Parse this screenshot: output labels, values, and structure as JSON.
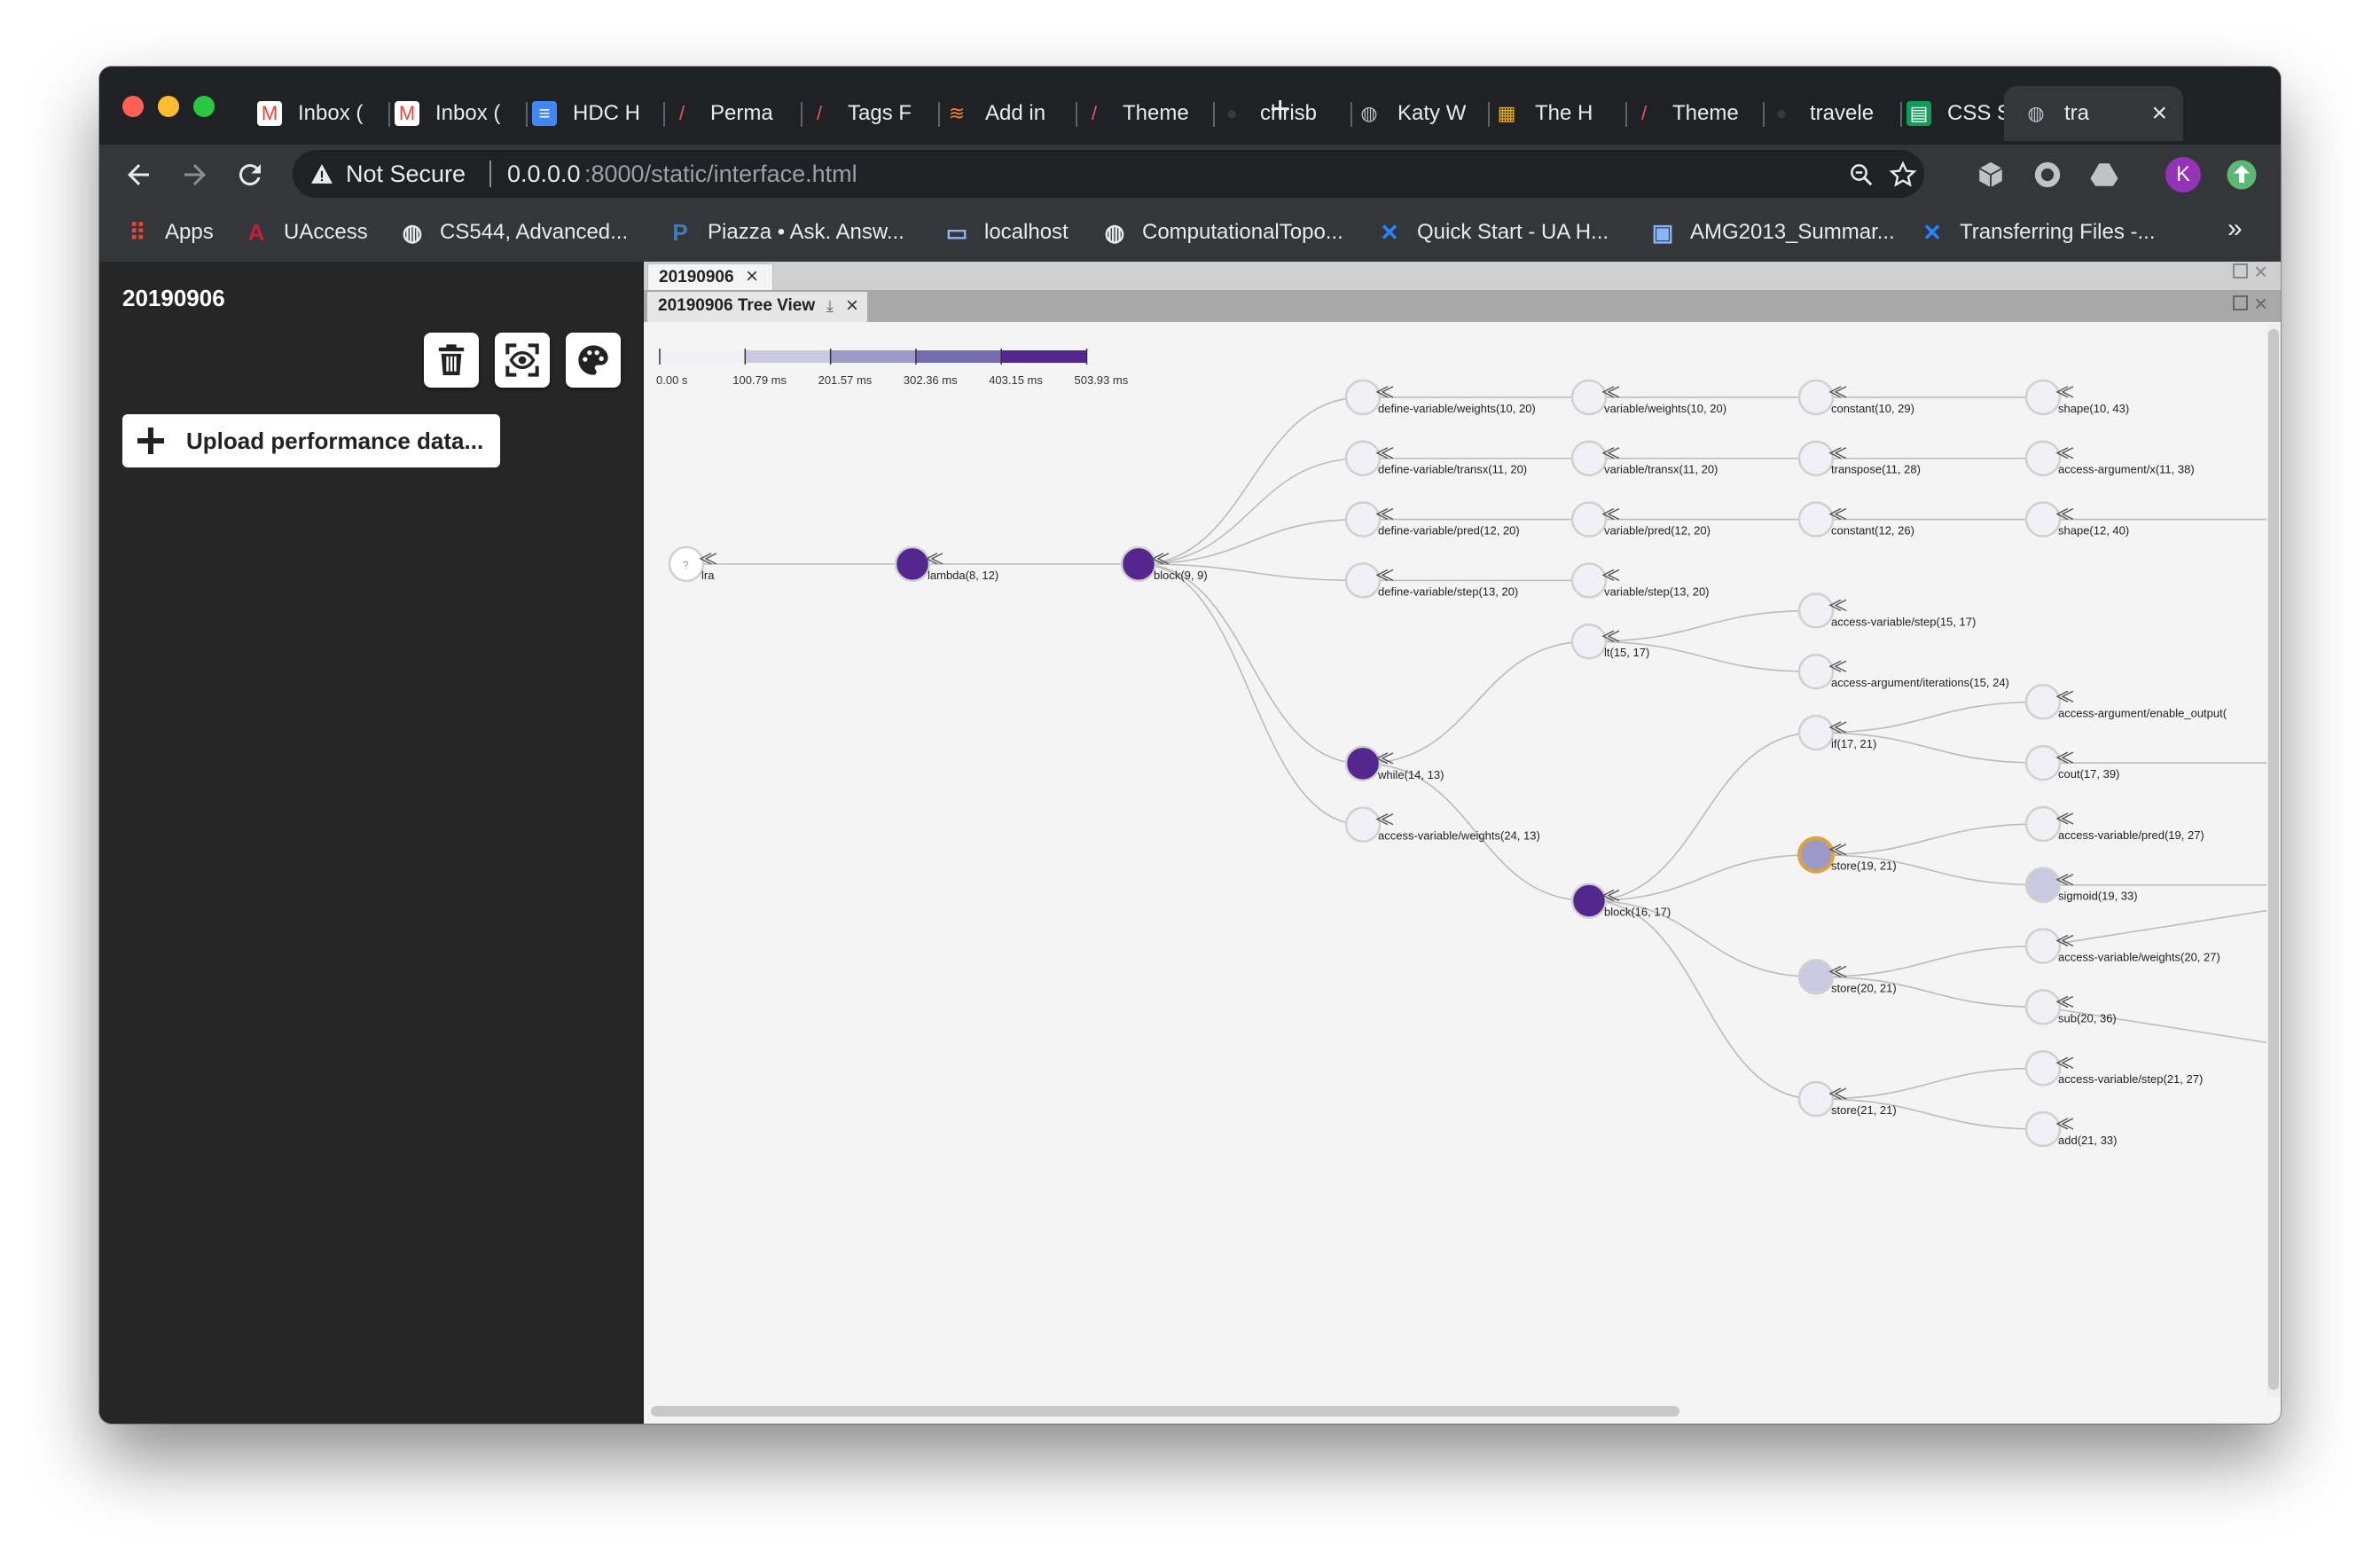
{
  "browser": {
    "tabs": [
      {
        "title": "Inbox (",
        "icon": "gmail-icon"
      },
      {
        "title": "Inbox (",
        "icon": "gmail-icon"
      },
      {
        "title": "HDC H",
        "icon": "docs-icon"
      },
      {
        "title": "Perma",
        "icon": "feather-icon"
      },
      {
        "title": "Tags F",
        "icon": "feather-icon"
      },
      {
        "title": "Add in",
        "icon": "stackoverflow-icon"
      },
      {
        "title": "Theme",
        "icon": "feather-icon"
      },
      {
        "title": "chrisb",
        "icon": "github-icon"
      },
      {
        "title": "Katy W",
        "icon": "globe-icon"
      },
      {
        "title": "The H",
        "icon": "colorful-icon"
      },
      {
        "title": "Theme",
        "icon": "feather-icon"
      },
      {
        "title": "travele",
        "icon": "github-icon"
      },
      {
        "title": "CSS S",
        "icon": "sheets-icon"
      },
      {
        "title": "tra",
        "icon": "globe-icon",
        "active": true
      }
    ],
    "new_tab": "+",
    "address": {
      "security": "Not Secure",
      "host": "0.0.0.0",
      "path": ":8000/static/interface.html"
    },
    "avatar_letter": "K",
    "bookmarks": [
      {
        "label": "Apps",
        "icon": "apps-grid-icon"
      },
      {
        "label": "UAccess",
        "icon": "ua-logo-icon"
      },
      {
        "label": "CS544, Advanced...",
        "icon": "globe-icon"
      },
      {
        "label": "Piazza • Ask. Answ...",
        "icon": "piazza-icon"
      },
      {
        "label": "localhost",
        "icon": "localhost-icon"
      },
      {
        "label": "ComputationalTopo...",
        "icon": "globe-icon"
      },
      {
        "label": "Quick Start - UA H...",
        "icon": "confluence-icon"
      },
      {
        "label": "AMG2013_Summar...",
        "icon": "doc-icon"
      },
      {
        "label": "Transferring Files -...",
        "icon": "confluence-icon"
      }
    ],
    "more_bookmarks": "»"
  },
  "sidebar": {
    "title": "20190906",
    "tools": [
      "trash-icon",
      "focus-eye-icon",
      "palette-icon"
    ],
    "upload_label": "Upload performance data..."
  },
  "panel": {
    "outer_tab": "20190906",
    "inner_tab": "20190906 Tree View"
  },
  "legend": {
    "ticks": [
      "0.00 s",
      "100.79 ms",
      "201.57 ms",
      "302.36 ms",
      "403.15 ms",
      "503.93 ms"
    ],
    "colors": [
      "#f2f0f7",
      "#cbc9e2",
      "#9e9ac8",
      "#756bb1",
      "#54278f"
    ]
  },
  "tree": {
    "nodes": [
      {
        "label": "lra",
        "fill": "#ffffff",
        "question": "?"
      },
      {
        "label": "lambda(8, 12)",
        "fill": "#54278f"
      },
      {
        "label": "block(9, 9)",
        "fill": "#54278f"
      },
      {
        "label": "define-variable/weights(10, 20)",
        "fill": "#f2f0f7"
      },
      {
        "label": "define-variable/transx(11, 20)",
        "fill": "#f2f0f7"
      },
      {
        "label": "define-variable/pred(12, 20)",
        "fill": "#f2f0f7"
      },
      {
        "label": "define-variable/step(13, 20)",
        "fill": "#f2f0f7"
      },
      {
        "label": "while(14, 13)",
        "fill": "#54278f"
      },
      {
        "label": "access-variable/weights(24, 13)",
        "fill": "#f2f0f7"
      },
      {
        "label": "variable/weights(10, 20)",
        "fill": "#f2f0f7"
      },
      {
        "label": "variable/transx(11, 20)",
        "fill": "#f2f0f7"
      },
      {
        "label": "variable/pred(12, 20)",
        "fill": "#f2f0f7"
      },
      {
        "label": "variable/step(13, 20)",
        "fill": "#f2f0f7"
      },
      {
        "label": "lt(15, 17)",
        "fill": "#f2f0f7"
      },
      {
        "label": "block(16, 17)",
        "fill": "#54278f"
      },
      {
        "label": "constant(10, 29)",
        "fill": "#f2f0f7"
      },
      {
        "label": "transpose(11, 28)",
        "fill": "#f2f0f7"
      },
      {
        "label": "constant(12, 26)",
        "fill": "#f2f0f7"
      },
      {
        "label": "access-variable/step(15, 17)",
        "fill": "#f2f0f7"
      },
      {
        "label": "access-argument/iterations(15, 24)",
        "fill": "#f2f0f7"
      },
      {
        "label": "if(17, 21)",
        "fill": "#f2f0f7"
      },
      {
        "label": "store(19, 21)",
        "fill": "#9e9ac8",
        "selected": true
      },
      {
        "label": "store(20, 21)",
        "fill": "#cbc9e2"
      },
      {
        "label": "store(21, 21)",
        "fill": "#f2f0f7"
      },
      {
        "label": "shape(10, 43)",
        "fill": "#f2f0f7"
      },
      {
        "label": "access-argument/x(11, 38)",
        "fill": "#f2f0f7"
      },
      {
        "label": "shape(12, 40)",
        "fill": "#f2f0f7"
      },
      {
        "label": "access-argument/enable_output(",
        "fill": "#f2f0f7"
      },
      {
        "label": "cout(17, 39)",
        "fill": "#f2f0f7"
      },
      {
        "label": "access-variable/pred(19, 27)",
        "fill": "#f2f0f7"
      },
      {
        "label": "sigmoid(19, 33)",
        "fill": "#cbc9e2"
      },
      {
        "label": "access-variable/weights(20, 27)",
        "fill": "#f2f0f7"
      },
      {
        "label": "sub(20, 36)",
        "fill": "#f2f0f7"
      },
      {
        "label": "access-variable/step(21, 27)",
        "fill": "#f2f0f7"
      },
      {
        "label": "add(21, 33)",
        "fill": "#f2f0f7"
      }
    ]
  }
}
